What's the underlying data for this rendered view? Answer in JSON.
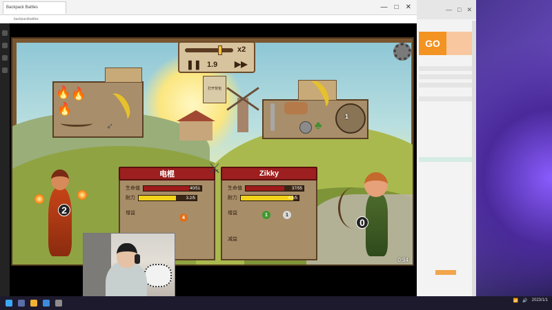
{
  "browser": {
    "tab_title": "Backpack Battles",
    "url": "backpackbattles",
    "window_controls": [
      "—",
      "□",
      "✕"
    ]
  },
  "side_browser": {
    "ad_text": "GO"
  },
  "game": {
    "speed": {
      "multiplier": "x2",
      "value": "1.9",
      "slider_position": 0.75,
      "pause_icon": "pause-icon",
      "fast_forward_icon": "fast-forward-icon"
    },
    "book_label": "打开背包",
    "player": {
      "name": "电棍",
      "health_label": "生命值",
      "health_value": "40/51",
      "health_fraction": 0.78,
      "stamina_label": "耐力",
      "stamina_value": "3.2/5",
      "stamina_fraction": 0.64,
      "buffs_label": "增益",
      "debuffs_label": "减益",
      "stack_count": "2",
      "debuff_count": "4",
      "colors": {
        "health": "#9e1b1b",
        "stamina": "#f2d21a"
      }
    },
    "opponent": {
      "name": "Zikky",
      "health_label": "生命值",
      "health_value": "37/55",
      "health_fraction": 0.67,
      "stamina_label": "耐力",
      "stamina_value": "4.5/5",
      "stamina_fraction": 0.9,
      "buffs_label": "增益",
      "debuffs_label": "减益",
      "stack_count": "0",
      "buff_counts": [
        "1",
        "1"
      ],
      "colors": {
        "health": "#9e1b1b",
        "stamina": "#f2d21a"
      }
    },
    "player_items": [
      "fire-icon",
      "fire-icon",
      "fire-icon",
      "banana-icon",
      "bow-icon",
      "arrow-icon"
    ],
    "opponent_items": [
      "dagger-icon",
      "gloves-icon",
      "banana-icon",
      "rock-icon",
      "clover-icon",
      "shield-icon"
    ],
    "item_count": "1",
    "timer": "0:94"
  },
  "taskbar": {
    "time": "2023/1/1"
  }
}
